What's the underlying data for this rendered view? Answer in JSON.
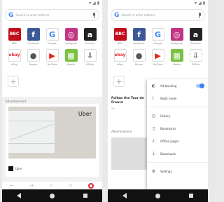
{
  "search": {
    "placeholder": "Search or enter address"
  },
  "speed_dials": [
    {
      "label": "BBC",
      "icon": "bbc-icon",
      "color": "#c20e1a",
      "glyph": "BBC"
    },
    {
      "label": "Facebook",
      "icon": "facebook-icon",
      "color": "#3b5998",
      "glyph": "f"
    },
    {
      "label": "Google",
      "icon": "google-icon",
      "color": "#ffffff",
      "glyph": "G"
    },
    {
      "label": "Instagram",
      "icon": "instagram-icon",
      "color": "#c13584",
      "glyph": "◎"
    },
    {
      "label": "Amazon",
      "icon": "amazon-icon",
      "color": "#222222",
      "glyph": "a"
    },
    {
      "label": "eBay",
      "icon": "ebay-icon",
      "color": "#ffffff",
      "glyph": "ebay"
    },
    {
      "label": "Nissan",
      "icon": "nissan-icon",
      "color": "#ffffff",
      "glyph": "●"
    },
    {
      "label": "YouTube",
      "icon": "youtube-icon",
      "color": "#ffffff",
      "glyph": "▶"
    },
    {
      "label": "Mobile",
      "icon": "mobile-icon",
      "color": "#7ac143",
      "glyph": "▦"
    },
    {
      "label": "Offline",
      "icon": "offline-icon",
      "color": "#ffffff",
      "glyph": "⇩"
    }
  ],
  "feed": {
    "label": "Advertisement",
    "brand": "Uber",
    "source": "Uber"
  },
  "news": {
    "title": "Follow the Tour de France",
    "meta": "2h",
    "sep": "Advertisement"
  },
  "menu": [
    {
      "label": "Ad blocking",
      "icon": "shield-icon"
    },
    {
      "label": "Night mode",
      "icon": "moon-icon"
    },
    {
      "label": "History",
      "icon": "history-icon"
    },
    {
      "label": "Bookmarks",
      "icon": "bookmark-icon"
    },
    {
      "label": "Offline pages",
      "icon": "offline-pages-icon"
    },
    {
      "label": "Downloads",
      "icon": "download-icon"
    },
    {
      "label": "Settings",
      "icon": "settings-icon"
    }
  ]
}
